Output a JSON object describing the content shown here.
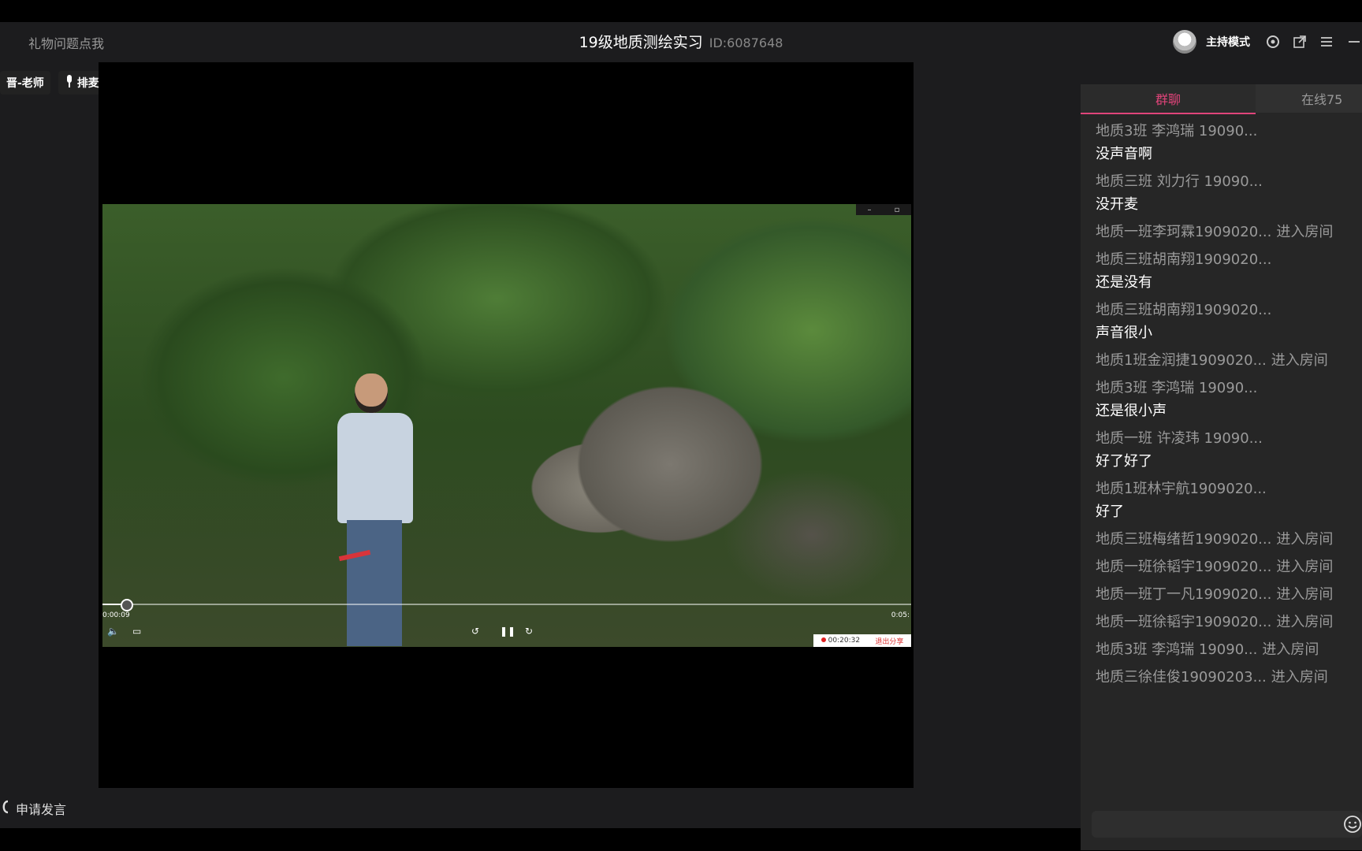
{
  "header": {
    "gift_link": "礼物问题点我",
    "title": "19级地质测绘实习",
    "room_id": "ID:6087648",
    "host_mode": "主持模式"
  },
  "left_tools": {
    "teacher_label": "晋-老师",
    "queue_mic": "排麦"
  },
  "video": {
    "time_current": "0:00:09",
    "time_total": "0:05:",
    "progress_fraction": 0.03,
    "rec_time": "00:20:32",
    "exit_share": "退出分享"
  },
  "apply_speak": "申请发言",
  "sidebar": {
    "tab_chat": "群聊",
    "tab_online": "在线75",
    "messages": [
      {
        "name": "地质3班 李鸿瑞 19090...",
        "text": "没声音啊",
        "enter": ""
      },
      {
        "name": "地质三班 刘力行 19090...",
        "text": "没开麦",
        "enter": ""
      },
      {
        "name": "地质一班李珂霖1909020...",
        "text": "",
        "enter": "进入房间"
      },
      {
        "name": "地质三班胡南翔1909020...",
        "text": "还是没有",
        "enter": ""
      },
      {
        "name": "地质三班胡南翔1909020...",
        "text": "声音很小",
        "enter": ""
      },
      {
        "name": "地质1班金润捷1909020...",
        "text": "",
        "enter": "进入房间"
      },
      {
        "name": "地质3班 李鸿瑞 19090...",
        "text": "还是很小声",
        "enter": ""
      },
      {
        "name": "地质一班 许凌玮 19090...",
        "text": "好了好了",
        "enter": ""
      },
      {
        "name": "地质1班林宇航1909020...",
        "text": "好了",
        "enter": ""
      },
      {
        "name": "地质三班梅绪哲1909020...",
        "text": "",
        "enter": "进入房间"
      },
      {
        "name": "地质一班徐韬宇1909020...",
        "text": "",
        "enter": "进入房间"
      },
      {
        "name": "地质一班丁一凡1909020...",
        "text": "",
        "enter": "进入房间"
      },
      {
        "name": "地质一班徐韬宇1909020...",
        "text": "",
        "enter": "进入房间"
      },
      {
        "name": "地质3班 李鸿瑞 19090...",
        "text": "",
        "enter": "进入房间"
      },
      {
        "name": "地质三徐佳俊19090203...",
        "text": "",
        "enter": "进入房间"
      }
    ]
  },
  "colors": {
    "accent": "#e0447a",
    "app_bg": "#1c1c1e",
    "sidebar_bg": "#262626"
  },
  "icons": [
    "settings-icon",
    "popout-icon",
    "menu-icon",
    "minimize-icon",
    "mic-icon",
    "phone-icon",
    "emoji-icon",
    "volume-icon",
    "subtitle-icon",
    "rewind-icon",
    "pause-icon",
    "forward-icon"
  ]
}
